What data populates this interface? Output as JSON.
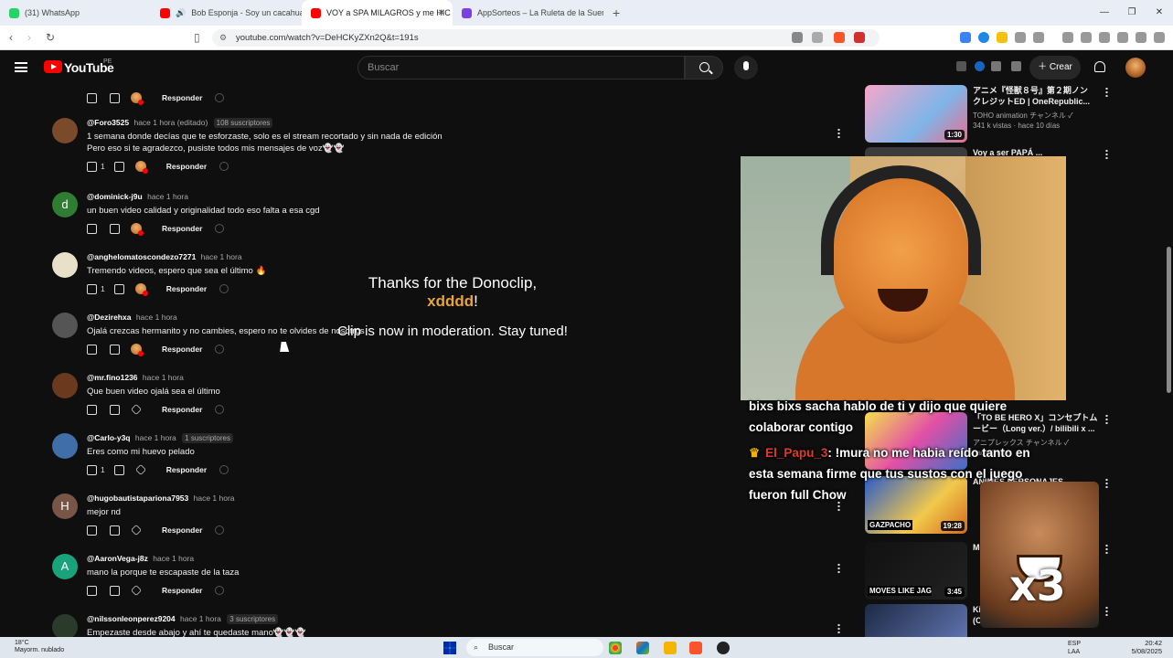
{
  "tabs": [
    {
      "label": "(31) WhatsApp",
      "color": "#25d366"
    },
    {
      "label": "Bob Esponja - Soy un cacahuate",
      "color": "#ff0000"
    },
    {
      "label": "VOY a SPA MILAGROS y me HIC",
      "color": "#ff0000"
    },
    {
      "label": "AppSorteos – La Ruleta de la Suerte",
      "color": "#7b3fe4"
    }
  ],
  "url": "youtube.com/watch?v=DeHCKyZXn2Q&t=191s",
  "yt": {
    "brand": "YouTube",
    "country": "PE",
    "search_placeholder": "Buscar",
    "create_label": "Crear",
    "notif_count": "9+"
  },
  "comments": [
    {
      "user": "@Foro3525",
      "time": "hace 1 hora (editado)",
      "sub": "108 suscriptores",
      "text": [
        "1 semana donde decías que te esforzaste, solo es el stream recortado y sin nada de edición",
        "Pero eso si te agradezco, pusiste todos mis mensajes de voz👻👻"
      ],
      "likes": "1",
      "reply": "Responder",
      "avatar_color": "#7a4a2a",
      "letter": ""
    },
    {
      "user": "@dominick-j9u",
      "time": "hace 1 hora",
      "sub": "",
      "text": [
        "un buen video calidad y originalidad todo eso falta a esa cgd"
      ],
      "likes": "",
      "reply": "Responder",
      "avatar_color": "#2e7d32",
      "letter": "d"
    },
    {
      "user": "@anghelomatoscondezo7271",
      "time": "hace 1 hora",
      "sub": "",
      "text": [
        "Tremendo videos, espero que sea el último 🔥"
      ],
      "likes": "1",
      "reply": "Responder",
      "avatar_color": "#e8e0c8",
      "letter": ""
    },
    {
      "user": "@Dezirehxa",
      "time": "hace 1 hora",
      "sub": "",
      "text": [
        "Ojalá crezcas hermanito y no cambies, espero no te olvides de nosotros"
      ],
      "likes": "",
      "reply": "Responder",
      "avatar_color": "#555555",
      "letter": ""
    },
    {
      "user": "@mr.fino1236",
      "time": "hace 1 hora",
      "sub": "",
      "text": [
        "Que buen video ojalá sea el último"
      ],
      "likes": "",
      "reply": "Responder",
      "avatar_color": "#6b3a1e",
      "letter": ""
    },
    {
      "user": "@Carlo-y3q",
      "time": "hace 1 hora",
      "sub": "1 suscriptores",
      "text": [
        "Eres como mi huevo pelado"
      ],
      "likes": "1",
      "reply": "Responder",
      "avatar_color": "#3f6ea8",
      "letter": ""
    },
    {
      "user": "@hugobautistapariona7953",
      "time": "hace 1 hora",
      "sub": "",
      "text": [
        "mejor nd"
      ],
      "likes": "",
      "reply": "Responder",
      "avatar_color": "#795548",
      "letter": "H"
    },
    {
      "user": "@AaronVega-j8z",
      "time": "hace 1 hora",
      "sub": "",
      "text": [
        "mano la porque te escapaste de la taza"
      ],
      "likes": "",
      "reply": "Responder",
      "avatar_color": "#1aa37a",
      "letter": "A"
    },
    {
      "user": "@nilssonleonperez9204",
      "time": "hace 1 hora",
      "sub": "3 suscriptores",
      "text": [
        "Empezaste desde abajo y ahí te quedaste mano👻👻👻"
      ],
      "likes": "",
      "reply": "Responder",
      "avatar_color": "#2b3b2b",
      "letter": ""
    }
  ],
  "top_reply": "Responder",
  "dono": {
    "line1": "Thanks for the Donoclip,",
    "name": "xdddd",
    "excl": "!",
    "line3": "Clip is now in moderation. Stay tuned!"
  },
  "sidebar": [
    {
      "title1": "アニメ『怪獣８号』第２期ノン",
      "title2": "クレジットED | OneRepublic...",
      "channel": "TOHO animation チャンネル ✓",
      "stats": "341 k vistas · hace 10 días",
      "dur": "1:30",
      "bg": "linear-gradient(135deg,#f6a7c9,#7fb5e8 60%,#e86f8f)"
    },
    {
      "title1": "Voy a ser PAPÁ ...",
      "title2": "",
      "channel": "",
      "stats": "",
      "dur": "",
      "bg": "#3b3b3b"
    },
    {
      "title1": "「TO BE HERO X」コンセプトム",
      "title2": "ービー（Long ver.）/ bilibili x ...",
      "channel": "アニプレックス チャンネル ✓",
      "stats": "hace 1 mes",
      "dur": "",
      "bg": "linear-gradient(135deg,#f5e04b,#e24fa6 50%,#3c70c9)"
    },
    {
      "title1": "ANIMES PERSONAJES",
      "title2": "",
      "channel": "",
      "stats": "",
      "dur": "19:28",
      "bg": "linear-gradient(135deg,#2a5bc9,#f2c94c 60%,#d2691e)",
      "tag": "GAZPACHO"
    },
    {
      "title1": "Moves Like Jagger",
      "title2": "",
      "channel": "",
      "stats": "",
      "dur": "3:45",
      "bg": "linear-gradient(135deg,#111,#222)",
      "tag": "MOVES LIKE JAGGER REMIX"
    },
    {
      "title1": "KiD RAiN - Falling in Love",
      "title2": "(Official Lyrics)",
      "channel": "",
      "stats": "",
      "dur": "",
      "bg": "linear-gradient(135deg,#1d2a44,#6a7fbf)"
    }
  ],
  "chat": [
    {
      "user": "",
      "text": [
        "bixs bixs sacha hablo de ti y dijo que quiere",
        "colaborar contigo"
      ]
    },
    {
      "user": "El_Papu_3",
      "text": [
        ": !mura no me habia reído tanto en",
        "esta semana firme que tus sustos con el juego",
        "fueron full Chow"
      ]
    }
  ],
  "meme_text": "x3",
  "taskbar": {
    "temp": "18°C",
    "weather": "Mayorm. nublado",
    "search": "Buscar",
    "lang1": "ESP",
    "lang2": "LAA",
    "time": "20:42",
    "date": "5/08/2025"
  }
}
